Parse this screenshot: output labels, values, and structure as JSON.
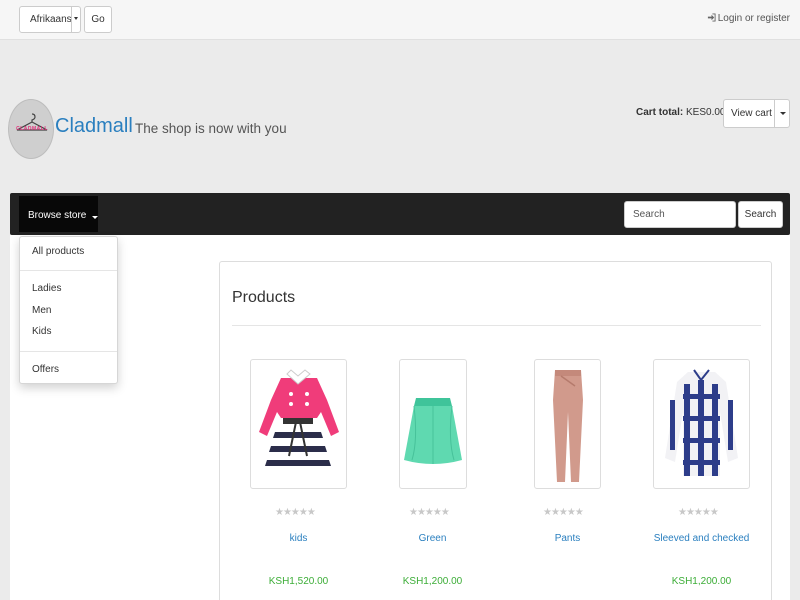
{
  "topbar": {
    "language_value": "Afrikaans",
    "go_label": "Go",
    "login_label": "Login or register"
  },
  "header": {
    "brand": "Cladmall",
    "tagline": "The shop is now with you",
    "logo_text": "CLADMALL",
    "cart_total_label": "Cart total:",
    "cart_total_value": "KES0.00",
    "view_cart_label": "View cart"
  },
  "navbar": {
    "browse_label": "Browse store",
    "search_placeholder": "Search",
    "search_button": "Search"
  },
  "dropdown": {
    "all_products": "All products",
    "ladies": "Ladies",
    "men": "Men",
    "kids": "Kids",
    "offers": "Offers"
  },
  "products_panel": {
    "title": "Products",
    "items": [
      {
        "name": "kids",
        "price": "KSH1,520.00",
        "stars": "★★★★★",
        "rating": 0
      },
      {
        "name": "Green",
        "price": "KSH1,200.00",
        "stars": "★★★★★",
        "rating": 0
      },
      {
        "name": "Pants",
        "price": "",
        "stars": "★★★★★",
        "rating": 0
      },
      {
        "name": "Sleeved and checked",
        "price": "KSH1,200.00",
        "stars": "★★★★★",
        "rating": 0
      }
    ]
  },
  "colors": {
    "brand_blue": "#2a7fbf",
    "price_green": "#3cad37",
    "navbar_dark": "#222222"
  }
}
